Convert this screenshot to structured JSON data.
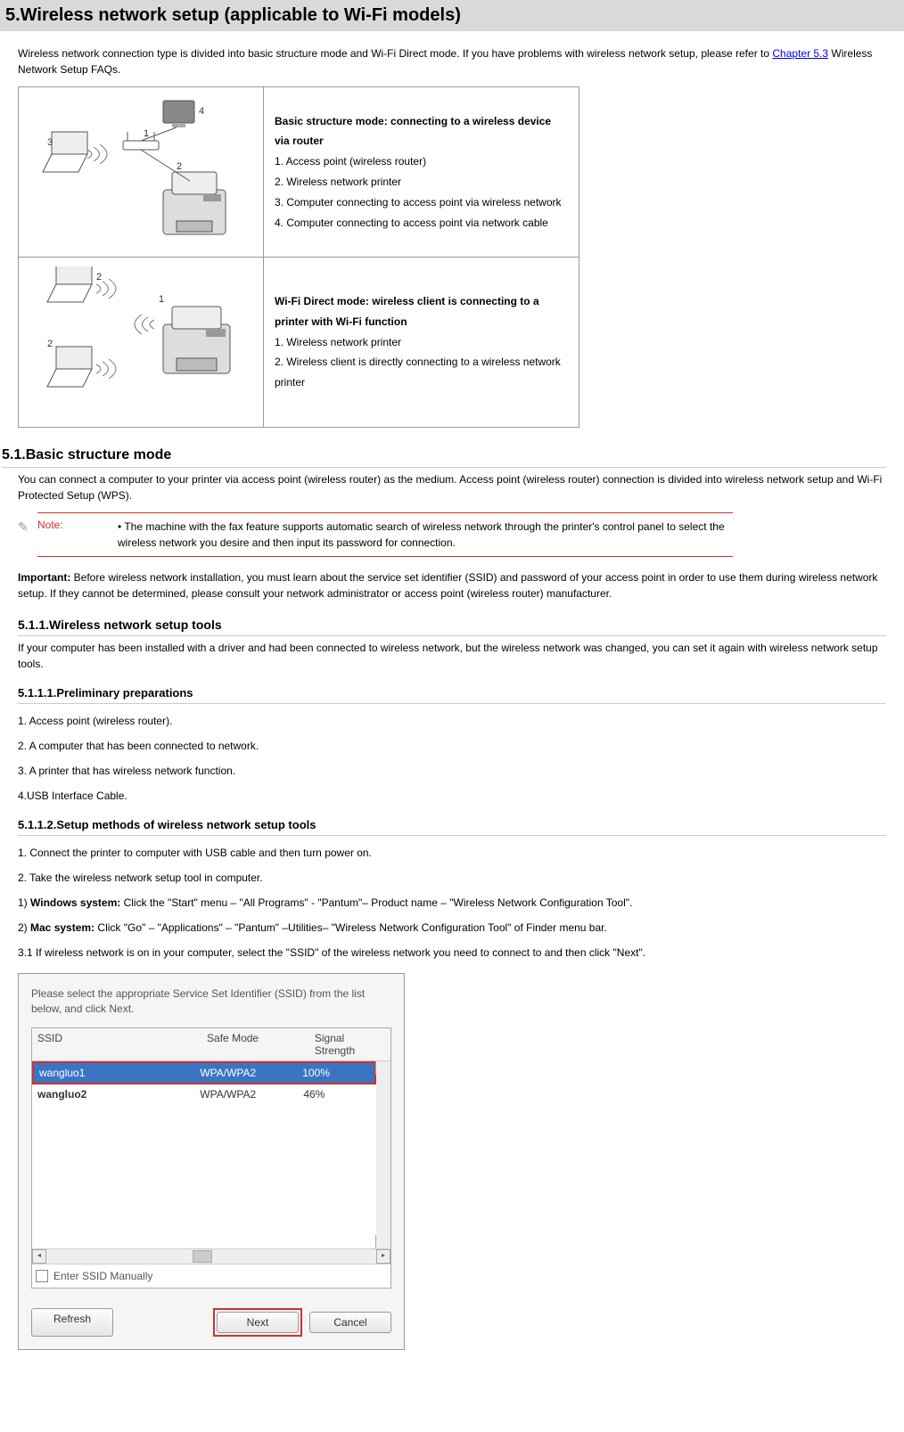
{
  "page": {
    "title": "5.Wireless network setup (applicable to Wi-Fi models)",
    "intro_pre": "Wireless network connection type is divided into basic structure mode and Wi-Fi Direct mode. If you have problems with wireless network setup, please refer to ",
    "intro_link": "Chapter 5.3",
    "intro_post": " Wireless Network Setup FAQs."
  },
  "diagram": {
    "row1": {
      "title": "Basic structure mode: connecting to a wireless device via router",
      "items": [
        "1. Access point (wireless router)",
        "2. Wireless network printer",
        "3. Computer connecting to access point via wireless network",
        "4. Computer connecting to access point via network cable"
      ],
      "labels": {
        "l1": "1",
        "l2": "2",
        "l3": "3",
        "l4": "4"
      }
    },
    "row2": {
      "title": "Wi-Fi Direct mode: wireless client is connecting to a printer with Wi-Fi function",
      "items": [
        "1. Wireless network printer",
        "2. Wireless client is directly connecting to a wireless network printer"
      ],
      "labels": {
        "l1": "1",
        "l2_top": "2",
        "l2_bot": "2"
      }
    }
  },
  "s51": {
    "heading": "5.1.Basic structure mode",
    "para": "You can connect a computer to your printer via access point (wireless router) as the medium. Access point (wireless router) connection is divided into wireless network setup and Wi-Fi Protected Setup (WPS).",
    "note_label": "Note:",
    "note_text": "• The machine with the fax feature supports automatic search of wireless network through the printer's control panel to select the wireless network you desire and then input its password for connection.",
    "important_label": "Important:",
    "important_text": " Before wireless network installation, you must learn about the service set identifier (SSID) and password of your access point in order to use them during wireless network setup. If they cannot be determined, please consult your network administrator or access point (wireless router) manufacturer."
  },
  "s511": {
    "heading": "5.1.1.Wireless network setup tools",
    "para": "If your computer has been installed with a driver and had been connected to wireless network, but the wireless network was changed, you can set it again with wireless network setup tools."
  },
  "s5111": {
    "heading": "5.1.1.1.Preliminary preparations",
    "items": [
      "1. Access point (wireless router).",
      "2. A computer that has been connected to network.",
      "3. A printer that has wireless network function.",
      "4.USB Interface Cable."
    ]
  },
  "s5112": {
    "heading": "5.1.1.2.Setup methods of wireless network setup tools",
    "step1": "1. Connect the printer to computer with USB cable and then turn power on.",
    "step2": "2. Take the wireless network setup tool in computer.",
    "win_label": "Windows system:",
    "win_text": " Click the \"Start\" menu – \"All Programs\" - \"Pantum\"– Product name – \"Wireless Network Configuration Tool\".",
    "mac_label": "Mac system:",
    "mac_text": " Click \"Go\" – \"Applications\" – \"Pantum\" –Utilities– \"Wireless Network Configuration Tool\" of Finder menu bar.",
    "step31": "3.1 If wireless network is on in your computer, select the \"SSID\" of the wireless network you need to connect to and then click \"Next\"."
  },
  "dialog": {
    "instruction": "Please select the appropriate Service Set Identifier (SSID) from the list below, and click Next.",
    "headers": {
      "ssid": "SSID",
      "mode": "Safe Mode",
      "signal": "Signal Strength"
    },
    "rows": [
      {
        "ssid": "wangluo1",
        "mode": "WPA/WPA2",
        "signal": "100%",
        "selected": true
      },
      {
        "ssid": "wangluo2",
        "mode": "WPA/WPA2",
        "signal": "46%",
        "selected": false
      }
    ],
    "manual_label": "Enter SSID Manually",
    "buttons": {
      "refresh": "Refresh",
      "next": "Next",
      "cancel": "Cancel"
    }
  }
}
